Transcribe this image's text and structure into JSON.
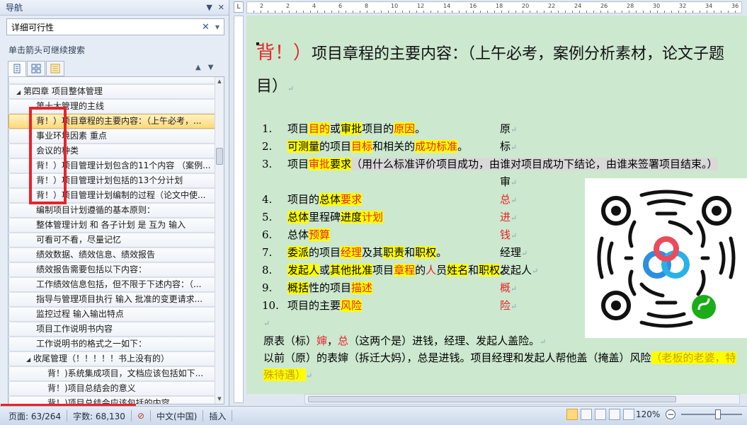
{
  "nav": {
    "title": "导航",
    "search_value": "详细可行性",
    "hint": "单击箭头可继续搜索",
    "tree": [
      {
        "label": "",
        "indent": 26,
        "arrow": "",
        "selected": false,
        "top": true
      },
      {
        "label": "第四章 项目整体管理",
        "indent": 10,
        "arrow": "◢",
        "selected": false
      },
      {
        "label": "第十大管理的主线",
        "indent": 38,
        "arrow": "",
        "selected": false
      },
      {
        "label": "背！）项目章程的主要内容：（上午必考，...",
        "indent": 38,
        "arrow": "",
        "selected": true
      },
      {
        "label": "事业环境因素 重点",
        "indent": 38,
        "arrow": "",
        "selected": false
      },
      {
        "label": "会议的种类",
        "indent": 38,
        "arrow": "",
        "selected": false
      },
      {
        "label": "背！）项目管理计划包含的11个内容 （案例...",
        "indent": 38,
        "arrow": "",
        "selected": false
      },
      {
        "label": "背！）项目管理计划包括的13个分计划",
        "indent": 38,
        "arrow": "",
        "selected": false
      },
      {
        "label": "背！）项目管理计划编制的过程（论文中使...",
        "indent": 38,
        "arrow": "",
        "selected": false
      },
      {
        "label": "编制项目计划遵循的基本原则：",
        "indent": 38,
        "arrow": "",
        "selected": false
      },
      {
        "label": "整体管理计划 和 各子计划 是 互为 输入",
        "indent": 38,
        "arrow": "",
        "selected": false
      },
      {
        "label": "可看可不看，尽量记忆",
        "indent": 38,
        "arrow": "",
        "selected": false
      },
      {
        "label": "绩效数据、绩效信息、绩效报告",
        "indent": 38,
        "arrow": "",
        "selected": false
      },
      {
        "label": "绩效报告需要包括以下内容：",
        "indent": 38,
        "arrow": "",
        "selected": false
      },
      {
        "label": "工作绩效信息包括，但不限于下述内容：（...",
        "indent": 38,
        "arrow": "",
        "selected": false
      },
      {
        "label": "指导与管理项目执行 输入 批准的变更请求...",
        "indent": 38,
        "arrow": "",
        "selected": false
      },
      {
        "label": "监控过程 输入输出特点",
        "indent": 38,
        "arrow": "",
        "selected": false
      },
      {
        "label": "项目工作说明书内容",
        "indent": 38,
        "arrow": "",
        "selected": false
      },
      {
        "label": "工作说明书的格式之一如下：",
        "indent": 38,
        "arrow": "",
        "selected": false
      },
      {
        "label": "收尾管理（！！！！！书上没有的）",
        "indent": 24,
        "arrow": "◢",
        "selected": false
      },
      {
        "label": "背！)系统集成项目，文档应该包括如下...",
        "indent": 54,
        "arrow": "",
        "selected": false
      },
      {
        "label": "背！)项目总结会的意义",
        "indent": 54,
        "arrow": "",
        "selected": false
      },
      {
        "label": "背！)项目总结会应该包括的内容",
        "indent": 54,
        "arrow": "",
        "selected": false
      }
    ]
  },
  "ruler": {
    "corner": "L",
    "nums": [
      "2",
      "2",
      "4",
      "6",
      "8",
      "10",
      "12",
      "14",
      "16",
      "18",
      "20",
      "22",
      "24",
      "26",
      "28",
      "30",
      "32",
      "34",
      "36",
      "38"
    ]
  },
  "doc": {
    "heading": {
      "prefix": "背！）",
      "text": "项目章程的主要内容：（上午必考，案例分析素材，论文子题目）"
    },
    "items": [
      {
        "num": "1.",
        "parts": [
          [
            "项目",
            ""
          ],
          [
            "目的",
            "hl-red"
          ],
          [
            "或",
            ""
          ],
          [
            "审批",
            "hl"
          ],
          [
            "项目的",
            ""
          ],
          [
            "原因",
            "hl-red"
          ],
          [
            "。",
            ""
          ]
        ],
        "side": "原"
      },
      {
        "num": "2.",
        "parts": [
          [
            "可测量",
            "hl"
          ],
          [
            "的项目",
            ""
          ],
          [
            "目标",
            "hl-red"
          ],
          [
            "和相关的",
            ""
          ],
          [
            "成功标准",
            "hl-red"
          ],
          [
            "。",
            ""
          ]
        ],
        "side": "标"
      },
      {
        "num": "3.",
        "parts": [
          [
            "项目",
            ""
          ],
          [
            "审批",
            "hl-red"
          ],
          [
            "要求",
            "hl"
          ],
          [
            "（用什么标准评价项目成功，由谁对项目成功下结论，由谁来签署项目结束。）",
            "grey"
          ]
        ],
        "side": "审",
        "wrap": true
      },
      {
        "num": "4.",
        "parts": [
          [
            "项目的",
            ""
          ],
          [
            "总体",
            "hl"
          ],
          [
            "要求",
            "hl-red"
          ]
        ],
        "side": "总",
        "side_red": true
      },
      {
        "num": "5.",
        "parts": [
          [
            "总体",
            "hl"
          ],
          [
            "里程碑",
            ""
          ],
          [
            "进度",
            "hl"
          ],
          [
            "计划",
            "hl-red"
          ]
        ],
        "side": "进",
        "side_red": true
      },
      {
        "num": "6.",
        "parts": [
          [
            "总体",
            ""
          ],
          [
            "预算",
            "hl-red"
          ]
        ],
        "side": "钱",
        "side_red": true
      },
      {
        "num": "7.",
        "parts": [
          [
            "委派",
            "hl"
          ],
          [
            "的项目",
            ""
          ],
          [
            "经理",
            "hl-red"
          ],
          [
            "及其",
            ""
          ],
          [
            "职责",
            "hl"
          ],
          [
            "和",
            ""
          ],
          [
            "职权",
            "hl"
          ],
          [
            "。",
            ""
          ]
        ],
        "side": "经理"
      },
      {
        "num": "8.",
        "parts": [
          [
            "发起人",
            "hl"
          ],
          [
            "或",
            ""
          ],
          [
            "其他批准",
            "hl"
          ],
          [
            "项目",
            ""
          ],
          [
            "章程",
            "hl-red"
          ],
          [
            "的",
            ""
          ],
          [
            "人",
            "red"
          ],
          [
            "员",
            ""
          ],
          [
            "姓名",
            "hl"
          ],
          [
            "和",
            ""
          ],
          [
            "职权",
            "hl"
          ],
          [
            "。",
            ""
          ]
        ],
        "side": "发起人"
      },
      {
        "num": "9.",
        "parts": [
          [
            "概括",
            "hl"
          ],
          [
            "性的项目",
            ""
          ],
          [
            "描述",
            "hl-red"
          ]
        ],
        "side": "概",
        "side_red": true
      },
      {
        "num": "10.",
        "parts": [
          [
            "项目的主要",
            ""
          ],
          [
            "风险",
            "hl-red"
          ]
        ],
        "side": "险",
        "side_red": true
      }
    ],
    "para1_parts": [
      [
        "原表（标）",
        ""
      ],
      [
        "婶",
        "red"
      ],
      [
        "，",
        ""
      ],
      [
        "总",
        "red"
      ],
      [
        "（这两个是）进钱，经理、发起人盖险。",
        ""
      ]
    ],
    "para2_parts": [
      [
        "以前（原）的表婶（拆迁大妈），总是进钱。项目经理和发起人帮他盖（掩盖）风险",
        ""
      ],
      [
        "（老板的老婆，特殊待遇）",
        "hl-y"
      ]
    ]
  },
  "status": {
    "page": "页面: 63/264",
    "words": "字数: 68,130",
    "lang": "中文(中国)",
    "mode": "插入",
    "zoom": "120%",
    "zoom_level": 0.6
  },
  "colors": {
    "accent_red": "#e8232a",
    "highlight": "#ffff00",
    "doc_bg": "#cce8cf"
  }
}
